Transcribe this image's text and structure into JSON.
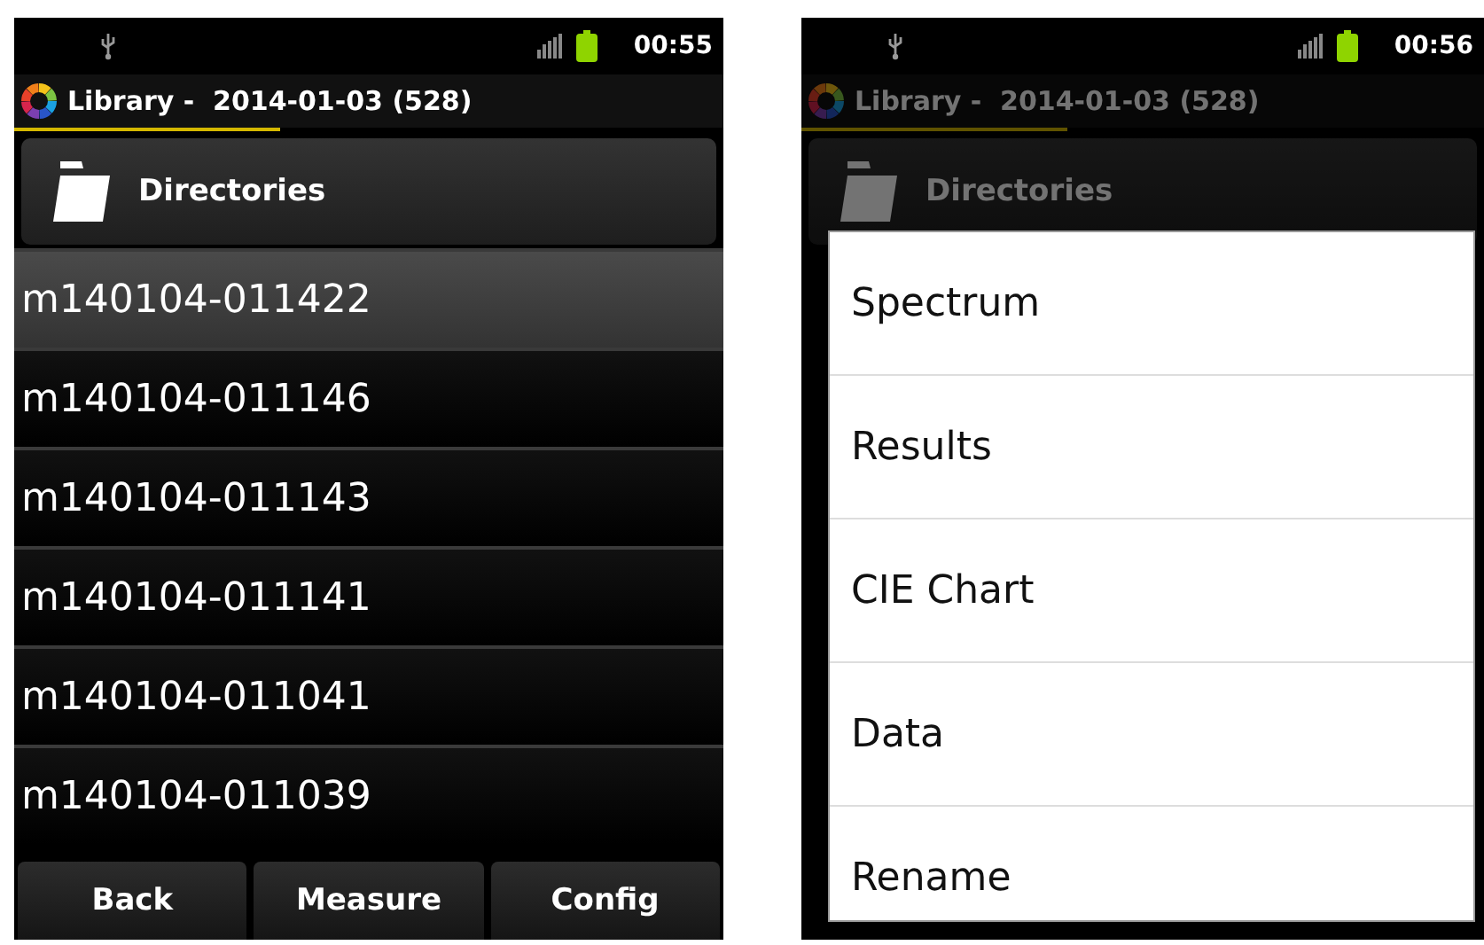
{
  "screens": [
    {
      "status_bar": {
        "time": "00:55"
      },
      "title": "Library -  2014-01-03 (528)",
      "directories_button": {
        "label": "Directories"
      },
      "dimmed": false,
      "rows": [
        {
          "label": "m140104-011422",
          "selected": true
        },
        {
          "label": "m140104-011146",
          "selected": false
        },
        {
          "label": "m140104-011143",
          "selected": false
        },
        {
          "label": "m140104-011141",
          "selected": false
        },
        {
          "label": "m140104-011041",
          "selected": false
        },
        {
          "label": "m140104-011039",
          "selected": false
        }
      ],
      "bottom_buttons": [
        "Back",
        "Measure",
        "Config"
      ]
    },
    {
      "status_bar": {
        "time": "00:56"
      },
      "title": "Library -  2014-01-03 (528)",
      "directories_button": {
        "label": "Directories"
      },
      "dimmed": true,
      "context_menu": [
        "Spectrum",
        "Results",
        "CIE Chart",
        "Data",
        "Rename"
      ]
    }
  ]
}
